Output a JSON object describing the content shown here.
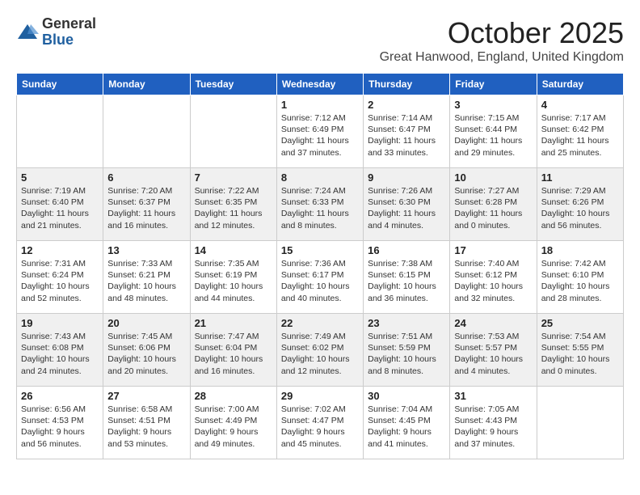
{
  "header": {
    "logo_general": "General",
    "logo_blue": "Blue",
    "month": "October 2025",
    "location": "Great Hanwood, England, United Kingdom"
  },
  "weekdays": [
    "Sunday",
    "Monday",
    "Tuesday",
    "Wednesday",
    "Thursday",
    "Friday",
    "Saturday"
  ],
  "weeks": [
    [
      {
        "day": "",
        "info": ""
      },
      {
        "day": "",
        "info": ""
      },
      {
        "day": "",
        "info": ""
      },
      {
        "day": "1",
        "info": "Sunrise: 7:12 AM\nSunset: 6:49 PM\nDaylight: 11 hours\nand 37 minutes."
      },
      {
        "day": "2",
        "info": "Sunrise: 7:14 AM\nSunset: 6:47 PM\nDaylight: 11 hours\nand 33 minutes."
      },
      {
        "day": "3",
        "info": "Sunrise: 7:15 AM\nSunset: 6:44 PM\nDaylight: 11 hours\nand 29 minutes."
      },
      {
        "day": "4",
        "info": "Sunrise: 7:17 AM\nSunset: 6:42 PM\nDaylight: 11 hours\nand 25 minutes."
      }
    ],
    [
      {
        "day": "5",
        "info": "Sunrise: 7:19 AM\nSunset: 6:40 PM\nDaylight: 11 hours\nand 21 minutes."
      },
      {
        "day": "6",
        "info": "Sunrise: 7:20 AM\nSunset: 6:37 PM\nDaylight: 11 hours\nand 16 minutes."
      },
      {
        "day": "7",
        "info": "Sunrise: 7:22 AM\nSunset: 6:35 PM\nDaylight: 11 hours\nand 12 minutes."
      },
      {
        "day": "8",
        "info": "Sunrise: 7:24 AM\nSunset: 6:33 PM\nDaylight: 11 hours\nand 8 minutes."
      },
      {
        "day": "9",
        "info": "Sunrise: 7:26 AM\nSunset: 6:30 PM\nDaylight: 11 hours\nand 4 minutes."
      },
      {
        "day": "10",
        "info": "Sunrise: 7:27 AM\nSunset: 6:28 PM\nDaylight: 11 hours\nand 0 minutes."
      },
      {
        "day": "11",
        "info": "Sunrise: 7:29 AM\nSunset: 6:26 PM\nDaylight: 10 hours\nand 56 minutes."
      }
    ],
    [
      {
        "day": "12",
        "info": "Sunrise: 7:31 AM\nSunset: 6:24 PM\nDaylight: 10 hours\nand 52 minutes."
      },
      {
        "day": "13",
        "info": "Sunrise: 7:33 AM\nSunset: 6:21 PM\nDaylight: 10 hours\nand 48 minutes."
      },
      {
        "day": "14",
        "info": "Sunrise: 7:35 AM\nSunset: 6:19 PM\nDaylight: 10 hours\nand 44 minutes."
      },
      {
        "day": "15",
        "info": "Sunrise: 7:36 AM\nSunset: 6:17 PM\nDaylight: 10 hours\nand 40 minutes."
      },
      {
        "day": "16",
        "info": "Sunrise: 7:38 AM\nSunset: 6:15 PM\nDaylight: 10 hours\nand 36 minutes."
      },
      {
        "day": "17",
        "info": "Sunrise: 7:40 AM\nSunset: 6:12 PM\nDaylight: 10 hours\nand 32 minutes."
      },
      {
        "day": "18",
        "info": "Sunrise: 7:42 AM\nSunset: 6:10 PM\nDaylight: 10 hours\nand 28 minutes."
      }
    ],
    [
      {
        "day": "19",
        "info": "Sunrise: 7:43 AM\nSunset: 6:08 PM\nDaylight: 10 hours\nand 24 minutes."
      },
      {
        "day": "20",
        "info": "Sunrise: 7:45 AM\nSunset: 6:06 PM\nDaylight: 10 hours\nand 20 minutes."
      },
      {
        "day": "21",
        "info": "Sunrise: 7:47 AM\nSunset: 6:04 PM\nDaylight: 10 hours\nand 16 minutes."
      },
      {
        "day": "22",
        "info": "Sunrise: 7:49 AM\nSunset: 6:02 PM\nDaylight: 10 hours\nand 12 minutes."
      },
      {
        "day": "23",
        "info": "Sunrise: 7:51 AM\nSunset: 5:59 PM\nDaylight: 10 hours\nand 8 minutes."
      },
      {
        "day": "24",
        "info": "Sunrise: 7:53 AM\nSunset: 5:57 PM\nDaylight: 10 hours\nand 4 minutes."
      },
      {
        "day": "25",
        "info": "Sunrise: 7:54 AM\nSunset: 5:55 PM\nDaylight: 10 hours\nand 0 minutes."
      }
    ],
    [
      {
        "day": "26",
        "info": "Sunrise: 6:56 AM\nSunset: 4:53 PM\nDaylight: 9 hours\nand 56 minutes."
      },
      {
        "day": "27",
        "info": "Sunrise: 6:58 AM\nSunset: 4:51 PM\nDaylight: 9 hours\nand 53 minutes."
      },
      {
        "day": "28",
        "info": "Sunrise: 7:00 AM\nSunset: 4:49 PM\nDaylight: 9 hours\nand 49 minutes."
      },
      {
        "day": "29",
        "info": "Sunrise: 7:02 AM\nSunset: 4:47 PM\nDaylight: 9 hours\nand 45 minutes."
      },
      {
        "day": "30",
        "info": "Sunrise: 7:04 AM\nSunset: 4:45 PM\nDaylight: 9 hours\nand 41 minutes."
      },
      {
        "day": "31",
        "info": "Sunrise: 7:05 AM\nSunset: 4:43 PM\nDaylight: 9 hours\nand 37 minutes."
      },
      {
        "day": "",
        "info": ""
      }
    ]
  ]
}
